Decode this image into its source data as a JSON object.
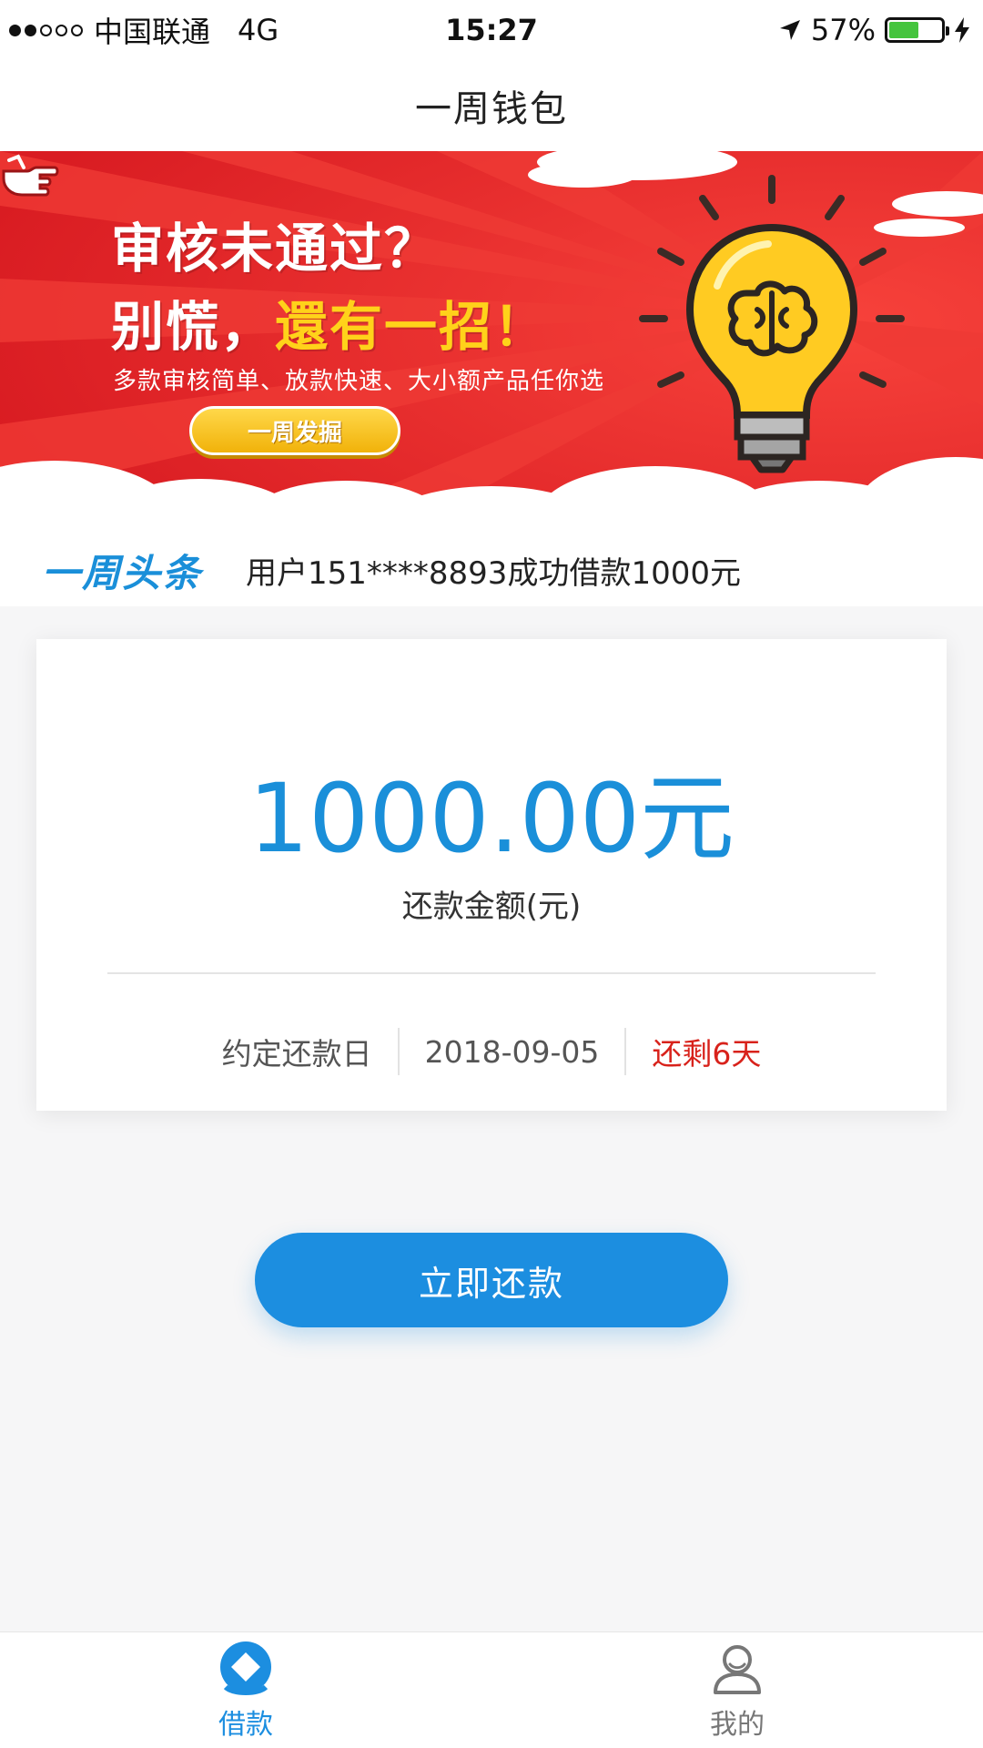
{
  "status_bar": {
    "carrier": "中国联通",
    "network": "4G",
    "time": "15:27",
    "battery_percent_text": "57%",
    "battery_level": 0.57
  },
  "nav": {
    "title": "一周钱包"
  },
  "banner": {
    "headline": "审核未通过？",
    "line2_prefix": "别慌，",
    "line2_highlight": "還有一招！",
    "subtitle": "多款审核简单、放款快速、大小额产品任你选",
    "button_label": "一周发掘"
  },
  "ticker": {
    "label": "一周头条",
    "text": "用户151****8893成功借款1000元"
  },
  "card": {
    "amount": "1000.00元",
    "amount_label": "还款金额(元)",
    "due_label": "约定还款日",
    "due_date": "2018-09-05",
    "remaining": "还剩6天"
  },
  "actions": {
    "repay_label": "立即还款"
  },
  "tabs": [
    {
      "label": "借款",
      "icon": "loan-icon",
      "active": true
    },
    {
      "label": "我的",
      "icon": "user-icon",
      "active": false
    }
  ],
  "colors": {
    "accent": "#1c8ee0",
    "banner_red": "#e8262a",
    "highlight_yellow": "#ffd21a",
    "due_red": "#d8221b"
  }
}
